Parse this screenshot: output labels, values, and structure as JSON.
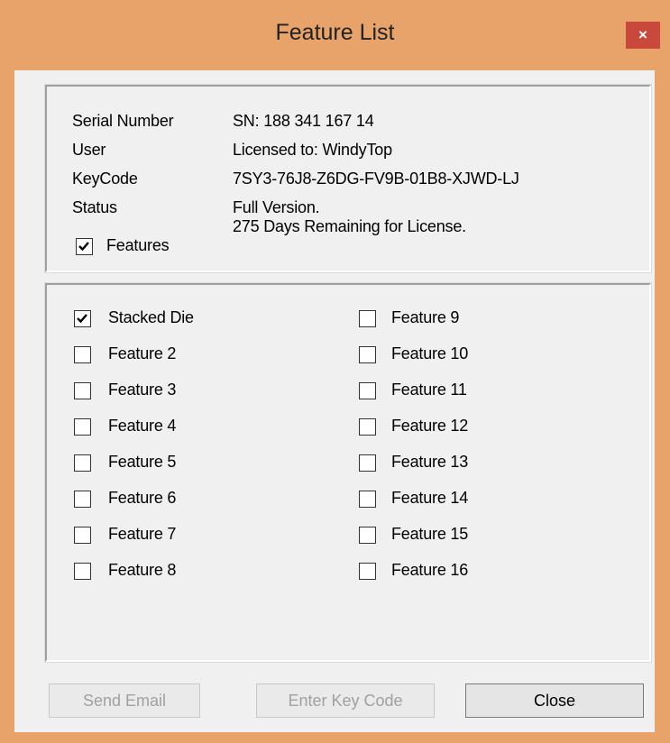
{
  "window": {
    "title": "Feature List",
    "close_glyph": "×"
  },
  "info": {
    "rows": [
      {
        "label": "Serial Number",
        "value": "SN: 188 341 167 14"
      },
      {
        "label": "User",
        "value": "Licensed to: WindyTop"
      },
      {
        "label": "KeyCode",
        "value": "7SY3-76J8-Z6DG-FV9B-01B8-XJWD-LJ"
      },
      {
        "label": "Status",
        "value": "Full Version."
      }
    ],
    "status_extra": "275 Days Remaining for License.",
    "features_toggle": {
      "label": "Features",
      "checked": true
    }
  },
  "features": {
    "left": [
      {
        "label": "Stacked Die",
        "checked": true
      },
      {
        "label": "Feature 2",
        "checked": false
      },
      {
        "label": "Feature 3",
        "checked": false
      },
      {
        "label": "Feature 4",
        "checked": false
      },
      {
        "label": "Feature 5",
        "checked": false
      },
      {
        "label": "Feature 6",
        "checked": false
      },
      {
        "label": "Feature 7",
        "checked": false
      },
      {
        "label": "Feature 8",
        "checked": false
      }
    ],
    "right": [
      {
        "label": "Feature 9",
        "checked": false
      },
      {
        "label": "Feature 10",
        "checked": false
      },
      {
        "label": "Feature 11",
        "checked": false
      },
      {
        "label": "Feature 12",
        "checked": false
      },
      {
        "label": "Feature 13",
        "checked": false
      },
      {
        "label": "Feature 14",
        "checked": false
      },
      {
        "label": "Feature 15",
        "checked": false
      },
      {
        "label": "Feature 16",
        "checked": false
      }
    ]
  },
  "buttons": {
    "send_email": {
      "label": "Send Email",
      "enabled": false
    },
    "enter_key_code": {
      "label": "Enter Key Code",
      "enabled": false
    },
    "close": {
      "label": "Close",
      "enabled": true
    }
  },
  "colors": {
    "title_bar": "#e8a36a",
    "close_button": "#c9483c",
    "client_background": "#f0f0f0",
    "disabled_text": "#a0a0a0"
  }
}
